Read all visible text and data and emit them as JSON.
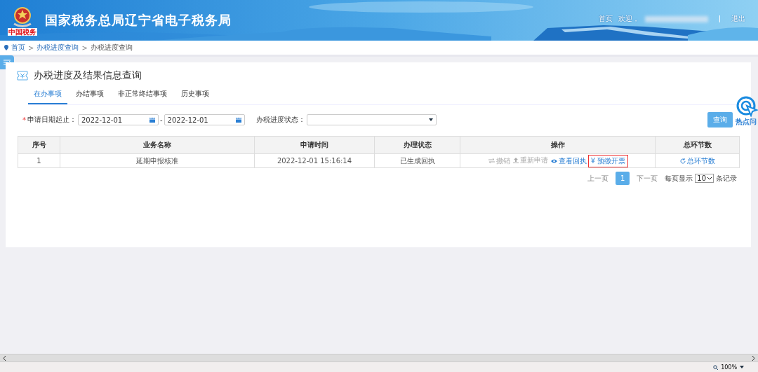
{
  "header": {
    "title": "国家税务总局辽宁省电子税务局",
    "nav": [
      {
        "label": "首页"
      },
      {
        "label": "欢迎，"
      },
      {
        "label": "退出"
      }
    ],
    "logo_caption": "中国税务"
  },
  "breadcrumb": [
    {
      "label": "首页",
      "link": true
    },
    {
      "separator": ">",
      "label": "办税进度查询",
      "link": true
    },
    {
      "separator": ">",
      "label": "办税进度查询",
      "link": false
    }
  ],
  "page_title": "办税进度及结果信息查询",
  "tabs": [
    {
      "label": "在办事项",
      "selected": true
    },
    {
      "label": "办结事项",
      "selected": false
    },
    {
      "label": "非正常终结事项",
      "selected": false
    },
    {
      "label": "历史事项",
      "selected": false
    }
  ],
  "filters": {
    "required_mark": "*",
    "date_label": "申请日期起止：",
    "date_from": "2022-12-01",
    "date_to": "2022-12-01",
    "separator": "-",
    "status_label": "办税进度状态：",
    "query_button": "查询"
  },
  "table": {
    "columns": [
      "序号",
      "业务名称",
      "申请时间",
      "办理状态",
      "操作",
      "总环节数"
    ],
    "rows": [
      {
        "index": "1",
        "name": "延期申报核准",
        "time": "2022-12-01 15:16:14",
        "status": "已生成回执",
        "actions": [
          {
            "label": "撤销",
            "kind": "swap",
            "disabled": true,
            "highlighted": false
          },
          {
            "label": "重新申请",
            "kind": "upload",
            "disabled": true,
            "highlighted": false
          },
          {
            "label": "查看回执",
            "kind": "eye",
            "disabled": false,
            "highlighted": false
          },
          {
            "label": "¥ 预缴开票",
            "kind": "plain",
            "disabled": false,
            "highlighted": true
          }
        ],
        "steps": "总环节数"
      }
    ]
  },
  "pagination": {
    "prev": "上一页",
    "pages": [
      {
        "label": "1",
        "selected": true
      }
    ],
    "next": "下一页",
    "per_page_label": "每页显示",
    "per_page": "10",
    "per_page_suffix": "条记录"
  },
  "help": {
    "label": "热点问"
  },
  "status_bar": {
    "zoom": "100%"
  }
}
